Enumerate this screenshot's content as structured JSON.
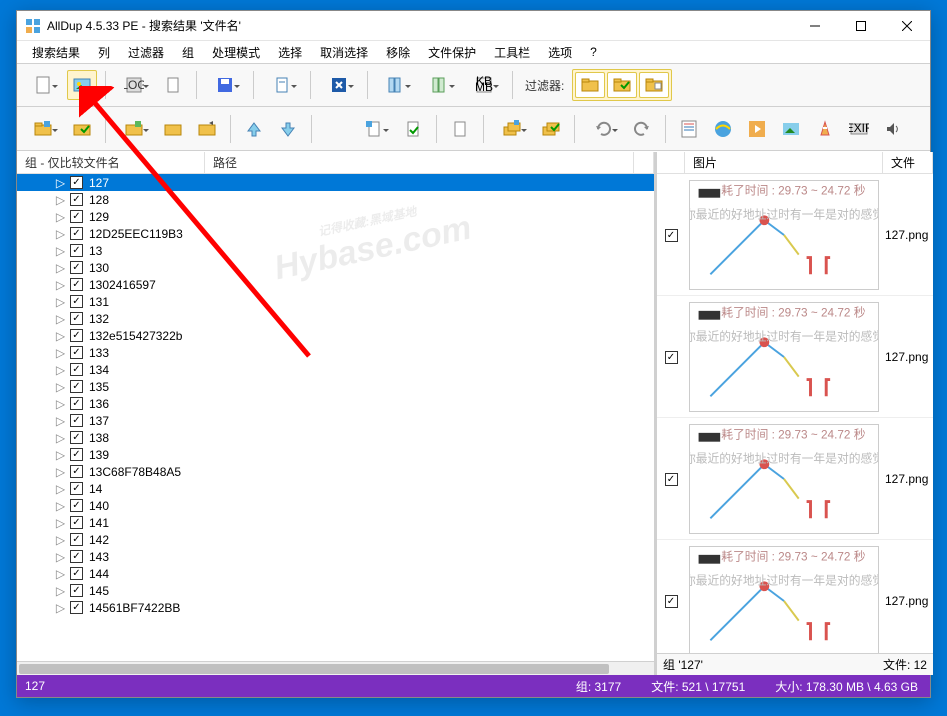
{
  "title": "AllDup 4.5.33 PE - 搜索结果 '文件名'",
  "menu": [
    "搜索结果",
    "列",
    "过滤器",
    "组",
    "处理模式",
    "选择",
    "取消选择",
    "移除",
    "文件保护",
    "工具栏",
    "选项",
    "?"
  ],
  "filterLabel": "过滤器:",
  "columns": {
    "group": "组 - 仅比较文件名",
    "path": "路径"
  },
  "rightColumns": {
    "image": "图片",
    "file": "文件"
  },
  "rows": [
    {
      "label": "127",
      "sel": true
    },
    {
      "label": "128"
    },
    {
      "label": "129"
    },
    {
      "label": "12D25EEC119B3"
    },
    {
      "label": "13"
    },
    {
      "label": "130"
    },
    {
      "label": "1302416597"
    },
    {
      "label": "131"
    },
    {
      "label": "132"
    },
    {
      "label": "132e515427322b"
    },
    {
      "label": "133"
    },
    {
      "label": "134"
    },
    {
      "label": "135"
    },
    {
      "label": "136"
    },
    {
      "label": "137"
    },
    {
      "label": "138"
    },
    {
      "label": "139"
    },
    {
      "label": "13C68F78B48A5"
    },
    {
      "label": "14"
    },
    {
      "label": "140"
    },
    {
      "label": "141"
    },
    {
      "label": "142"
    },
    {
      "label": "143"
    },
    {
      "label": "144"
    },
    {
      "label": "145"
    },
    {
      "label": "14561BF7422BB"
    }
  ],
  "rightItems": [
    {
      "file": "127.png"
    },
    {
      "file": "127.png"
    },
    {
      "file": "127.png"
    },
    {
      "file": "127.png"
    }
  ],
  "rightStatus": {
    "group": "组 '127'",
    "files": "文件: 12"
  },
  "status": {
    "left": "127",
    "groups": "组: 3177",
    "files": "文件: 521 \\ 17751",
    "size": "大小: 178.30 MB \\ 4.63 GB"
  }
}
